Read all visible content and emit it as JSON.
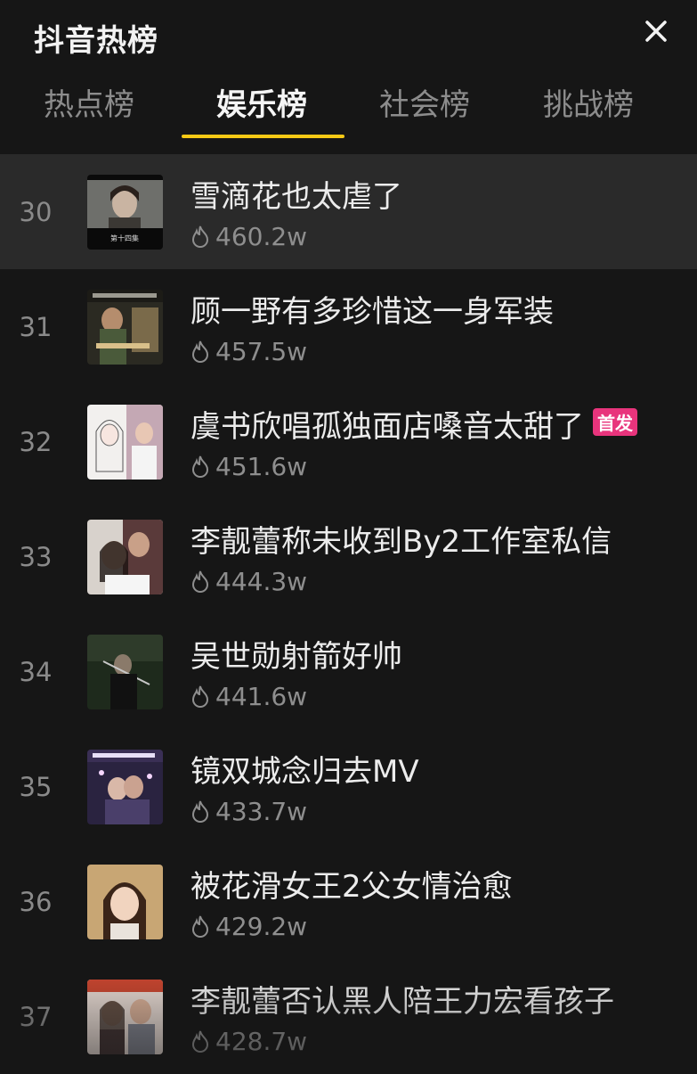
{
  "header": {
    "title": "抖音热榜"
  },
  "tabs": [
    {
      "label": "热点榜",
      "active": false
    },
    {
      "label": "娱乐榜",
      "active": true
    },
    {
      "label": "社会榜",
      "active": false
    },
    {
      "label": "挑战榜",
      "active": false
    }
  ],
  "colors": {
    "accent": "#f6c915",
    "badge": "#e8347c",
    "background": "#161616"
  },
  "items": [
    {
      "rank": "30",
      "title": "雪滴花也太虐了",
      "heat": "460.2w",
      "badge": "",
      "thumb_caption": "第十四集",
      "highlight": true
    },
    {
      "rank": "31",
      "title": "顾一野有多珍惜这一身军装",
      "heat": "457.5w",
      "badge": "",
      "thumb_caption": "",
      "highlight": false
    },
    {
      "rank": "32",
      "title": "虞书欣唱孤独面店嗓音太甜了",
      "heat": "451.6w",
      "badge": "首发",
      "thumb_caption": "",
      "highlight": false
    },
    {
      "rank": "33",
      "title": "李靓蕾称未收到By2工作室私信",
      "heat": "444.3w",
      "badge": "",
      "thumb_caption": "",
      "highlight": false
    },
    {
      "rank": "34",
      "title": "吴世勋射箭好帅",
      "heat": "441.6w",
      "badge": "",
      "thumb_caption": "",
      "highlight": false
    },
    {
      "rank": "35",
      "title": "镜双城念归去MV",
      "heat": "433.7w",
      "badge": "",
      "thumb_caption": "",
      "highlight": false
    },
    {
      "rank": "36",
      "title": "被花滑女王2父女情治愈",
      "heat": "429.2w",
      "badge": "",
      "thumb_caption": "",
      "highlight": false
    },
    {
      "rank": "37",
      "title": "李靓蕾否认黑人陪王力宏看孩子",
      "heat": "428.7w",
      "badge": "",
      "thumb_caption": "",
      "highlight": false
    }
  ]
}
